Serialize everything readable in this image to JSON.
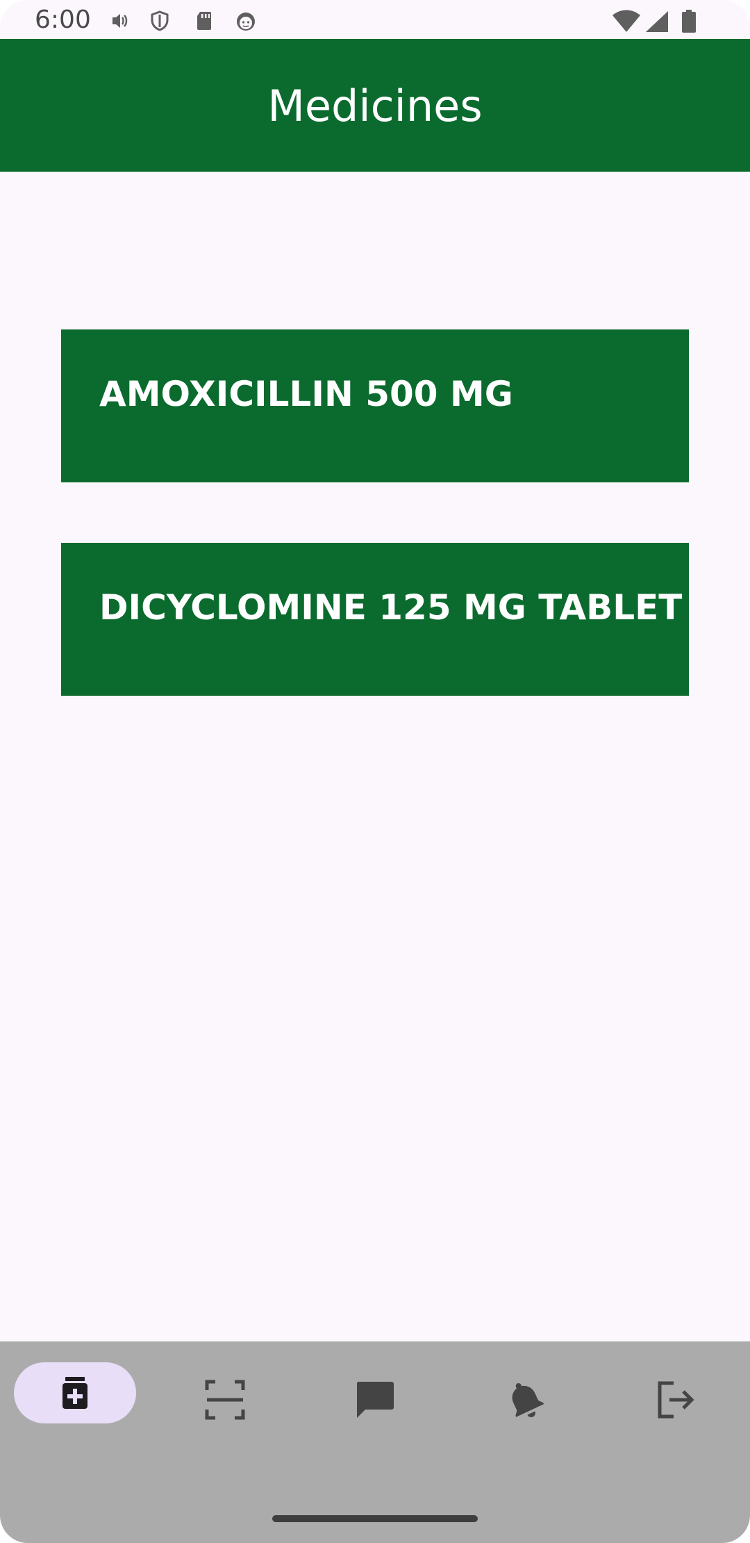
{
  "status_bar": {
    "time": "6:00",
    "icons": [
      "volume-vibrate-icon",
      "shield-icon",
      "sd-card-icon",
      "android-icon",
      "wifi-icon",
      "cell-signal-icon",
      "battery-icon"
    ]
  },
  "app_bar": {
    "title": "Medicines",
    "color": "#0b6b2e"
  },
  "medicines": [
    {
      "label": "AMOXICILLIN 500 MG"
    },
    {
      "label": "DICYCLOMINE 125 MG TABLET"
    }
  ],
  "bottom_nav": {
    "items": [
      {
        "icon": "medicine-bottle-icon",
        "selected": true
      },
      {
        "icon": "scan-icon",
        "selected": false
      },
      {
        "icon": "chat-icon",
        "selected": false
      },
      {
        "icon": "notification-bell-icon",
        "selected": false
      },
      {
        "icon": "logout-icon",
        "selected": false
      }
    ],
    "active_pill_color": "#e8def8",
    "background": "#ababab"
  }
}
